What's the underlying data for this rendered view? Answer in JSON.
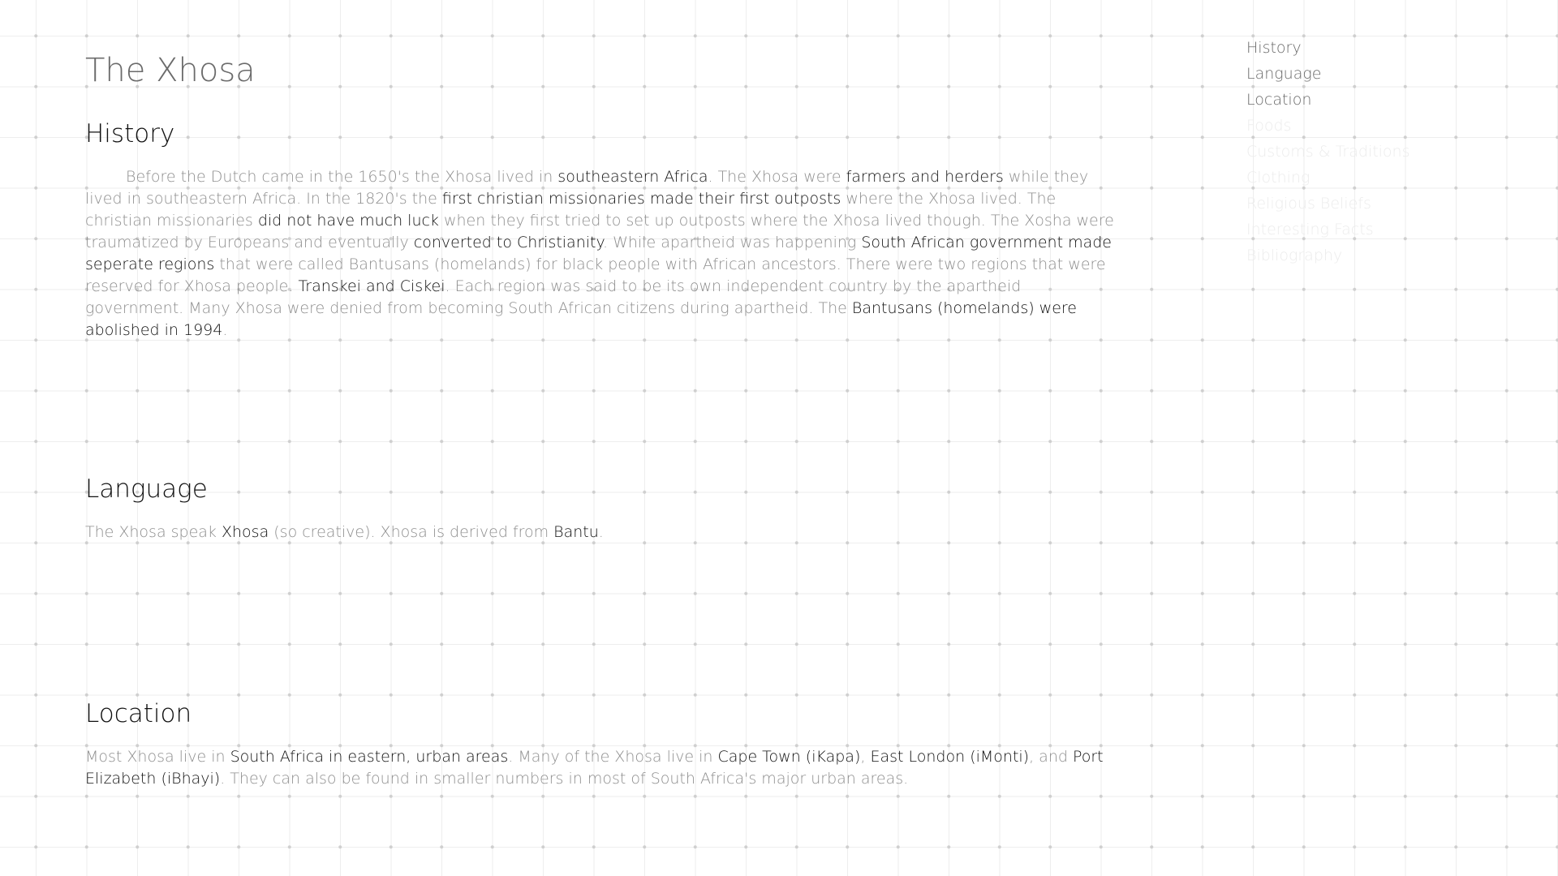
{
  "page": {
    "title": "The Xhosa"
  },
  "nav": {
    "items": [
      {
        "label": "History"
      },
      {
        "label": "Language"
      },
      {
        "label": "Location"
      },
      {
        "label": "Foods"
      },
      {
        "label": "Customs & Traditions"
      },
      {
        "label": "Clothing"
      },
      {
        "label": "Religious Beliefs"
      },
      {
        "label": "Interesting Facts"
      },
      {
        "label": "Bibliography"
      }
    ]
  },
  "history": {
    "heading": "History",
    "parts": [
      "Before the Dutch came in the 1650's the Xhosa lived in ",
      "southeastern Africa",
      ". The Xhosa were ",
      "farmers and herders",
      " while they lived in southeastern Africa. In the 1820's the ",
      "first christian missionaries made their first outposts",
      " where the Xhosa lived. The christian missionaries ",
      "did not have much luck",
      " when they first tried to set up outposts where the Xhosa lived though. The Xosha were traumatized by Europeans and eventually ",
      "converted to Christianity",
      ". While apartheid was happening ",
      "South African government made seperate regions",
      " that were called Bantusans (homelands) for black people with African ancestors. There were two regions that were reserved for Xhosa people. ",
      "Transkei and Ciskei",
      ". Each region was said to be its own independent country by the apartheid government. Many Xhosa were denied from becoming South African citizens during apartheid. The ",
      "Bantusans (homelands) were abolished in 1994",
      "."
    ]
  },
  "language": {
    "heading": "Language",
    "parts": [
      "The Xhosa speak ",
      "Xhosa",
      " (so creative). Xhosa is derived from ",
      "Bantu",
      "."
    ]
  },
  "location": {
    "heading": "Location",
    "parts": [
      "Most Xhosa live in ",
      "South Africa in eastern, urban areas",
      ". Many of the Xhosa live in ",
      "Cape Town (iKapa)",
      ", ",
      "East London (iMonti)",
      ", and ",
      "Port Elizabeth (iBhayi)",
      ". They can also be found in smaller numbers in most of South Africa's major urban areas."
    ]
  },
  "colors": {
    "background": "#ffffff",
    "heading": "#111111",
    "highlight": "#111111",
    "body_text": "#8e8e8e",
    "title": "#6b6b6b",
    "nav_active": "#6a6a6a",
    "nav_faded": "#ececec",
    "grid_line": "#eeeeee",
    "grid_dot": "#cfcfcf"
  }
}
